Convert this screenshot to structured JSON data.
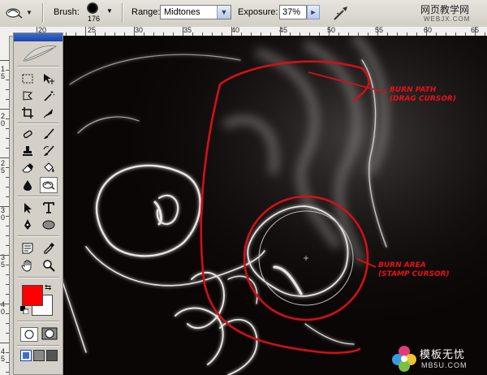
{
  "options_bar": {
    "tool_preset_icon": "burn-tool-icon",
    "brush_label": "Brush:",
    "brush_size": "176",
    "range_label": "Range:",
    "range_value": "Midtones",
    "exposure_label": "Exposure:",
    "exposure_value": "37%",
    "airbrush_icon": "airbrush-icon"
  },
  "watermark_top": {
    "text": "网页教学网",
    "sub": "WEBJX.COM"
  },
  "ruler": {
    "h_labels": [
      "20",
      "25",
      "30",
      "35",
      "40",
      "45",
      "50",
      "55",
      "60",
      "65"
    ],
    "v_labels": [
      "1 5",
      "2 0",
      "2 5",
      "3 0",
      "3 5",
      "4 0",
      "4 5"
    ]
  },
  "annotations": {
    "burn_path": [
      "BURN PATH",
      "(DRAG CURSOR)"
    ],
    "burn_area": [
      "BURN AREA",
      "(STAMP CURSOR)"
    ],
    "color": "#e8101a"
  },
  "watermark_bottom": {
    "text": "模板无忧",
    "sub": "MB5U.COM"
  },
  "toolbox": {
    "foreground_color": "#ff0000",
    "background_color": "#ffffff",
    "active_tool": "burn-tool",
    "tools": [
      "rectangular-marquee-icon",
      "move-icon",
      "lasso-icon",
      "magic-wand-icon",
      "crop-icon",
      "slice-icon",
      "healing-brush-icon",
      "brush-icon",
      "clone-stamp-icon",
      "history-brush-icon",
      "eraser-icon",
      "paint-bucket-icon",
      "blur-icon",
      "burn-icon",
      "path-selection-icon",
      "type-icon",
      "pen-icon",
      "ellipse-shape-icon",
      "notes-icon",
      "eyedropper-icon",
      "hand-icon",
      "zoom-icon"
    ]
  }
}
